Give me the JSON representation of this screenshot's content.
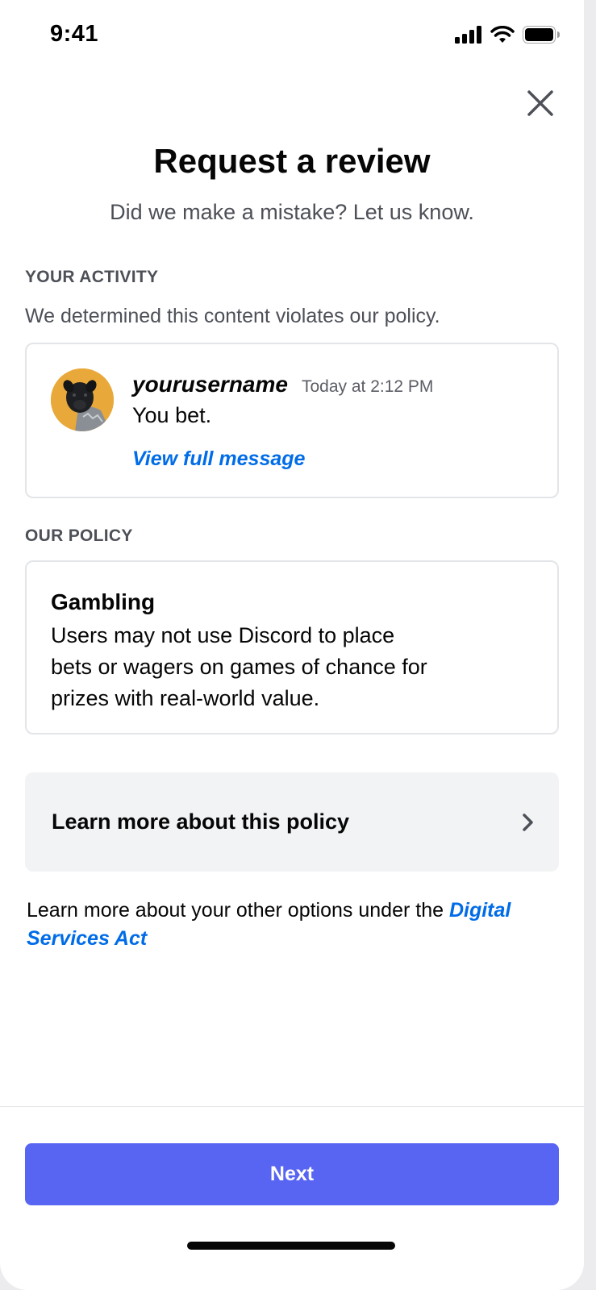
{
  "status_bar": {
    "time": "9:41"
  },
  "header": {
    "title": "Request a review",
    "subtitle": "Did we make a mistake? Let us know."
  },
  "activity": {
    "section_label": "YOUR ACTIVITY",
    "description": "We determined this content violates our policy.",
    "message": {
      "username": "yourusername",
      "timestamp": "Today at 2:12 PM",
      "text": "You bet.",
      "view_link": "View full message"
    }
  },
  "policy": {
    "section_label": "OUR POLICY",
    "title": "Gambling",
    "text": "Users may not use Discord to place bets or wagers on games of chance for prizes with real-world value."
  },
  "learn_more": {
    "label": "Learn more about this policy"
  },
  "dsa": {
    "prefix": "Learn more about your other options under the ",
    "link": "Digital Services Act"
  },
  "footer": {
    "next_label": "Next"
  },
  "colors": {
    "accent": "#5865f2",
    "link": "#006ce7",
    "avatar_bg": "#e9a93a"
  }
}
